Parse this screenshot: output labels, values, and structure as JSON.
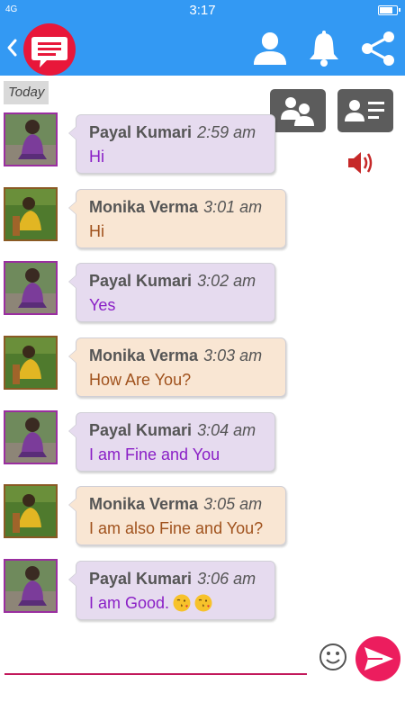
{
  "status_bar": {
    "time": "3:17",
    "signal": "4G"
  },
  "app_bar": {
    "back_icon": "chevron-left-icon",
    "logo_icon": "chat-bubble-icon",
    "actions": [
      "user-icon",
      "bell-icon",
      "share-icon"
    ]
  },
  "chat": {
    "date_label": "Today",
    "top_buttons": [
      "group-icon",
      "contact-card-icon"
    ],
    "speaker_icon": "speaker-icon",
    "messages": [
      {
        "sender": "Payal Kumari",
        "time": "2:59 am",
        "text": "Hi"
      },
      {
        "sender": "Monika Verma",
        "time": "3:01 am",
        "text": "Hi"
      },
      {
        "sender": "Payal Kumari",
        "time": "3:02 am",
        "text": "Yes"
      },
      {
        "sender": "Monika Verma",
        "time": "3:03 am",
        "text": "How Are You?"
      },
      {
        "sender": "Payal Kumari",
        "time": "3:04 am",
        "text": "I am Fine and You"
      },
      {
        "sender": "Monika Verma",
        "time": "3:05 am",
        "text": "I am also Fine and You?"
      },
      {
        "sender": "Payal Kumari",
        "time": "3:06 am",
        "text": "I am Good."
      }
    ]
  },
  "composer": {
    "placeholder": "",
    "emoji_icon": "smiley-icon",
    "send_icon": "send-icon"
  },
  "colors": {
    "primary": "#3399f3",
    "accent": "#ec1d5e",
    "payal_bubble": "#e6dbef",
    "monika_bubble": "#f9e6d3",
    "payal_text": "#8a1fc6",
    "monika_text": "#a0521d"
  }
}
